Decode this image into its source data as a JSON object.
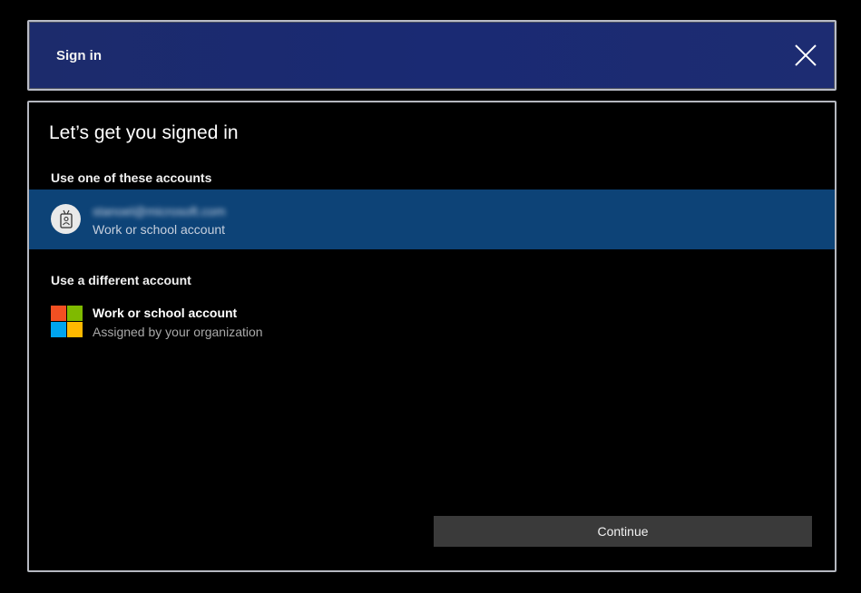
{
  "window": {
    "title": "Sign in",
    "close_icon": "close-icon"
  },
  "main": {
    "heading": "Let’s get you signed in",
    "existing_section_label": "Use one of these accounts",
    "existing_account": {
      "email": "stanoel@microsoft.com",
      "type": "Work or school account",
      "icon": "badge-icon"
    },
    "different_section_label": "Use a different account",
    "different_account": {
      "title": "Work or school account",
      "subtitle": "Assigned by your organization",
      "icon": "microsoft-logo-icon"
    },
    "continue_label": "Continue"
  },
  "colors": {
    "titlebar": "#1c2b6c",
    "selected_row": "#0d4377",
    "button": "#3a3a3a",
    "ms_red": "#f25022",
    "ms_green": "#7fba00",
    "ms_blue": "#00a4ef",
    "ms_yellow": "#ffb900"
  }
}
